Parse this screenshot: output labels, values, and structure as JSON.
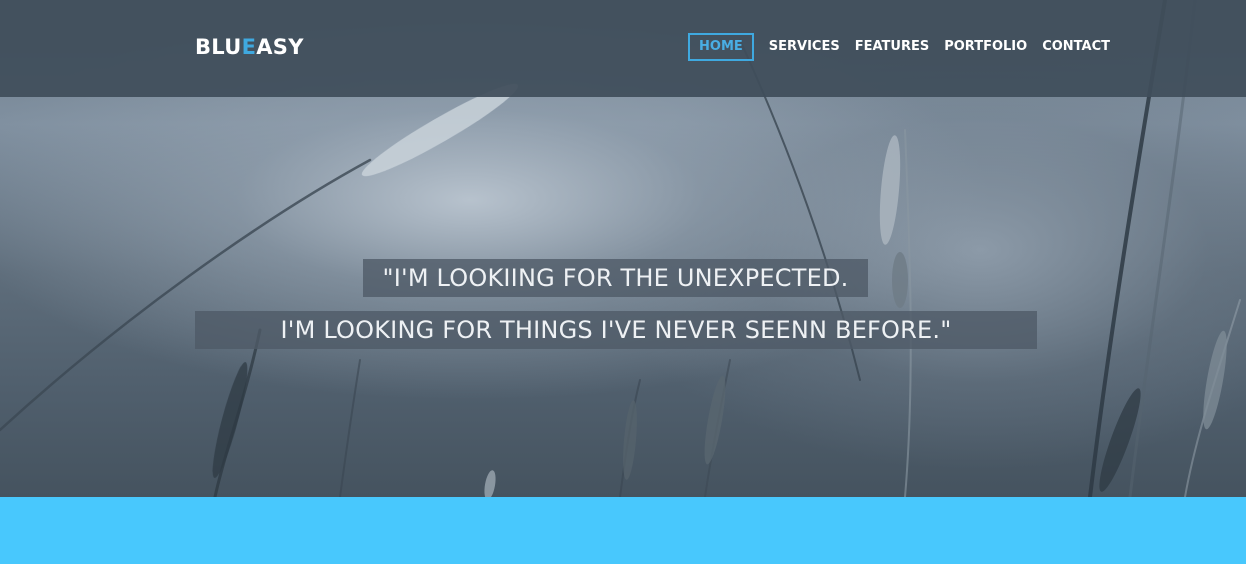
{
  "brand": {
    "logo_part1": "BLU",
    "logo_accent": "E",
    "logo_part2": "ASY"
  },
  "nav": {
    "items": [
      {
        "label": "HOME",
        "active": true
      },
      {
        "label": "SERVICES"
      },
      {
        "label": "FEATURES"
      },
      {
        "label": "PORTFOLIO"
      },
      {
        "label": "CONTACT"
      }
    ]
  },
  "hero": {
    "quote_line1": "\"I'M LOOKIING FOR THE UNEXPECTED.",
    "quote_line2": "I'M LOOKING FOR THINGS I'VE NEVER SEENN BEFORE.\""
  },
  "colors": {
    "accent": "#3fa9e0",
    "header_bg": "#404e5a",
    "band_bg": "#48c8fd"
  }
}
